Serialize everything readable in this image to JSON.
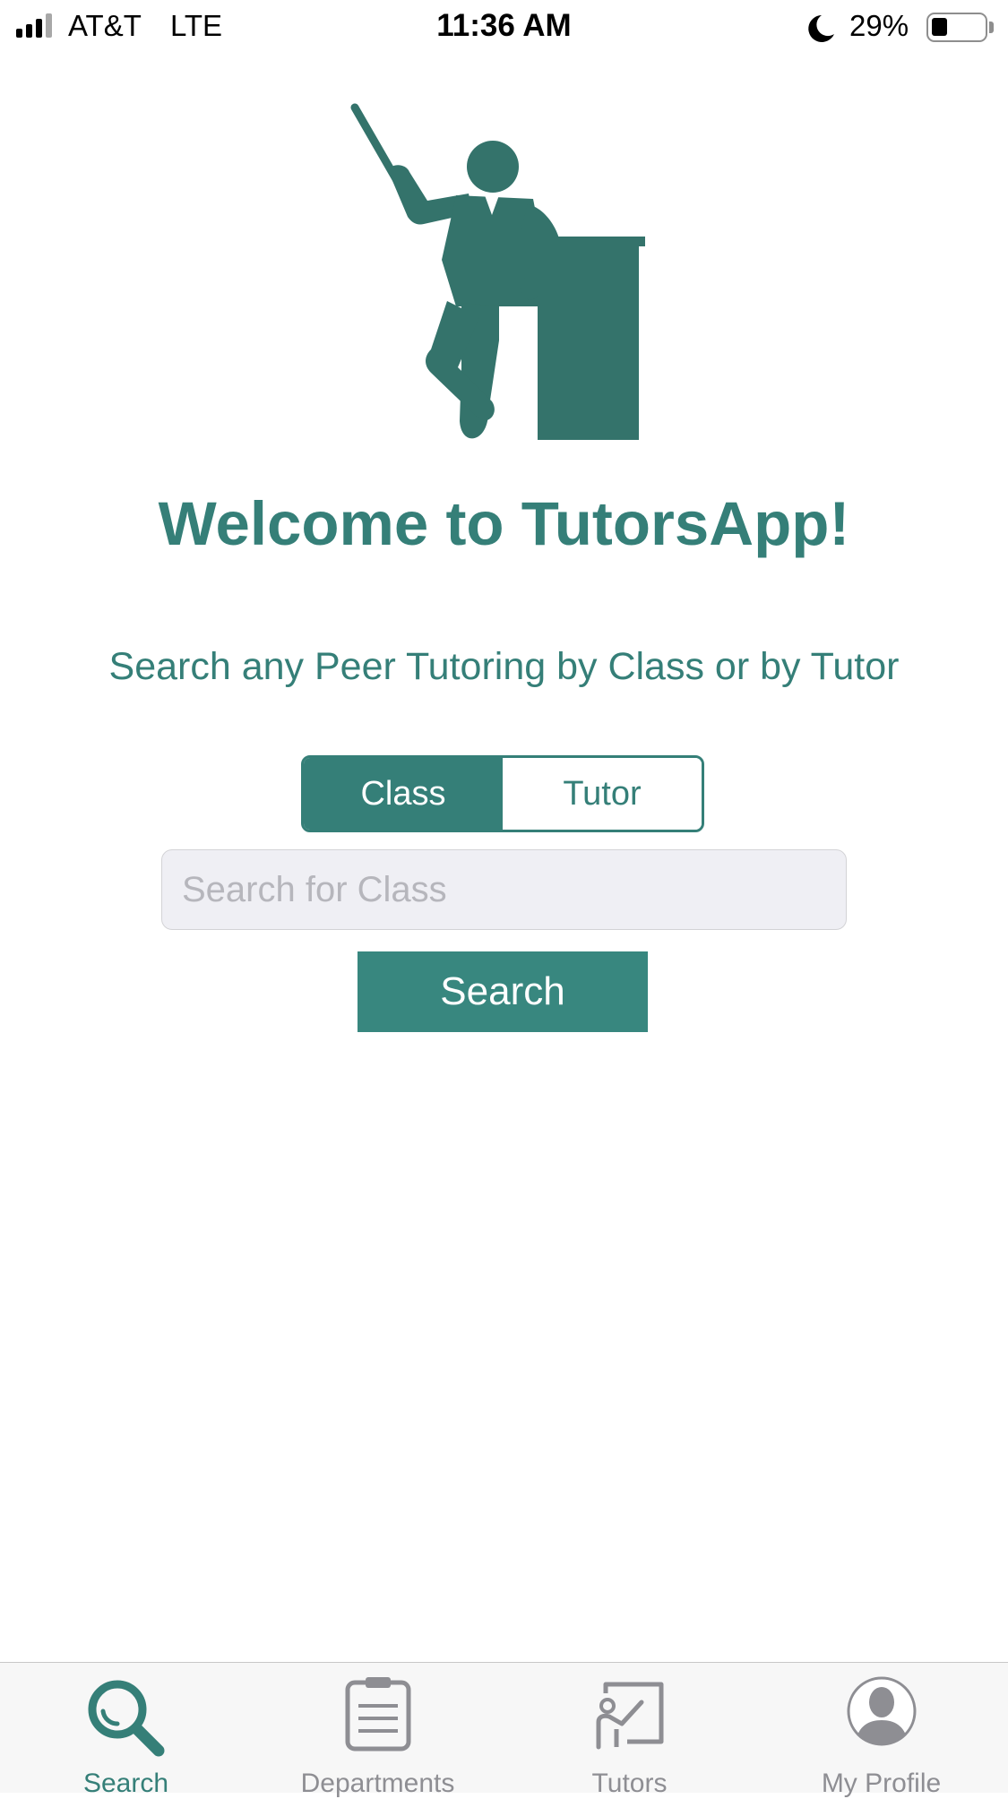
{
  "status_bar": {
    "carrier": "AT&T",
    "network": "LTE",
    "time": "11:36 AM",
    "battery_percent": "29%",
    "battery_level": 0.29,
    "icons": [
      "signal-icon",
      "moon-icon",
      "battery-icon"
    ]
  },
  "hero": {
    "icon": "teacher-at-desk-illustration"
  },
  "welcome": {
    "title": "Welcome to TutorsApp!",
    "subtitle": "Search any Peer Tutoring by Class or by Tutor"
  },
  "search": {
    "segments": [
      {
        "label": "Class",
        "selected": true
      },
      {
        "label": "Tutor",
        "selected": false
      }
    ],
    "input_value": "",
    "placeholder": "Search for Class",
    "button_label": "Search"
  },
  "tab_bar": {
    "tabs": [
      {
        "label": "Search",
        "icon": "search-icon",
        "active": true
      },
      {
        "label": "Departments",
        "icon": "clipboard-icon",
        "active": false
      },
      {
        "label": "Tutors",
        "icon": "presentation-icon",
        "active": false
      },
      {
        "label": "My Profile",
        "icon": "profile-icon",
        "active": false
      }
    ]
  },
  "colors": {
    "accent": "#357f78",
    "button": "#38877f",
    "input_background": "#efeff4",
    "tab_inactive": "#8e8e93"
  }
}
